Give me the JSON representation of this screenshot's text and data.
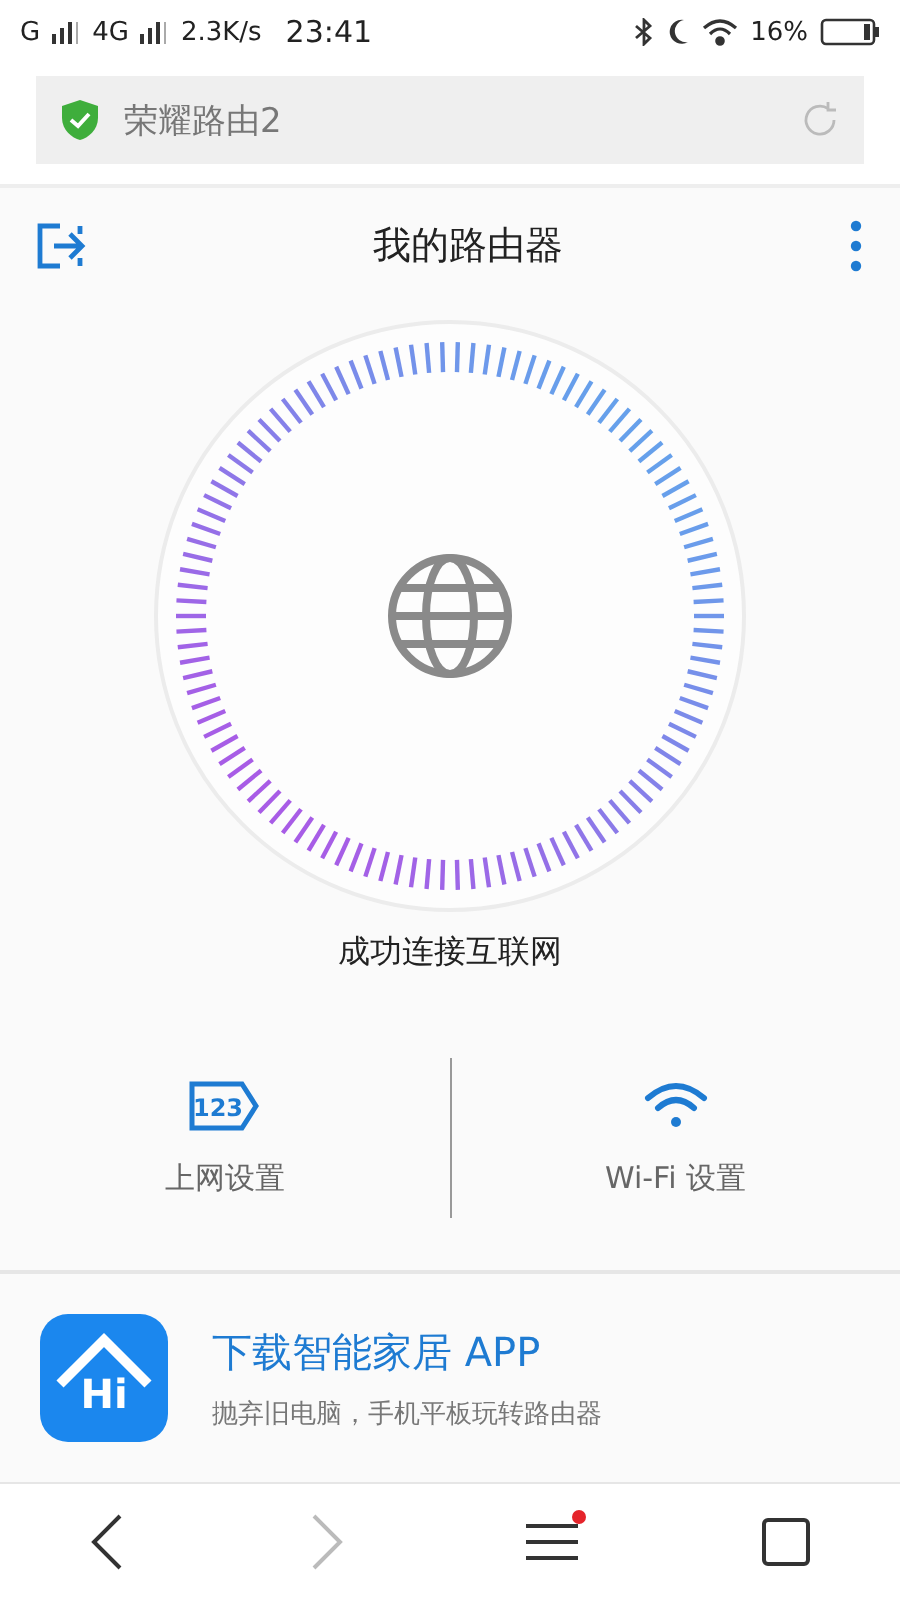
{
  "status_bar": {
    "network_1": "G",
    "network_2": "4G",
    "speed": "2.3K/s",
    "time": "23:41",
    "battery": "16%"
  },
  "address_bar": {
    "title": "荣耀路由2",
    "secure": true
  },
  "header": {
    "title": "我的路由器"
  },
  "connection": {
    "text": "成功连接互联网"
  },
  "actions": [
    {
      "kind": "internet",
      "tag_text": "123",
      "label": "上网设置"
    },
    {
      "kind": "wifi",
      "label": "Wi-Fi 设置"
    }
  ],
  "promo": {
    "logo_text": "Hi",
    "title": "下载智能家居 APP",
    "subtitle": "抛弃旧电脑，手机平板玩转路由器"
  },
  "browser_nav": [
    {
      "kind": "back",
      "disabled": false
    },
    {
      "kind": "forward",
      "disabled": true
    },
    {
      "kind": "menu",
      "badge": true
    },
    {
      "kind": "tabs",
      "disabled": false
    }
  ]
}
